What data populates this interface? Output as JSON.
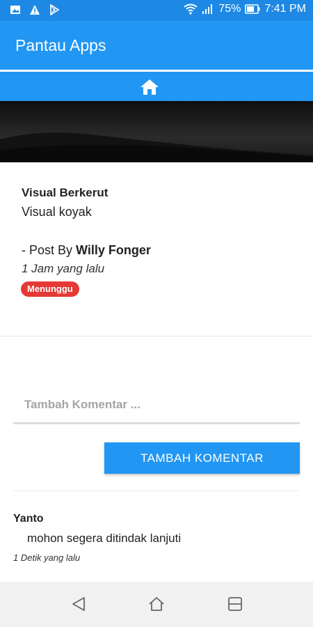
{
  "status_bar": {
    "battery": "75%",
    "time": "7:41 PM",
    "icons": [
      "image-icon",
      "warning-icon",
      "play-store-icon",
      "wifi-icon",
      "signal-icon",
      "battery-icon"
    ]
  },
  "app_bar": {
    "title": "Pantau Apps"
  },
  "home_bar": {
    "icon": "home-icon"
  },
  "post": {
    "title": "Visual Berkerut",
    "description": "Visual koyak",
    "by_prefix": "- Post By ",
    "author": "Willy Fonger",
    "time": "1 Jam yang lalu",
    "status": "Menunggu"
  },
  "comment_form": {
    "placeholder": "Tambah Komentar ...",
    "button_label": "TAMBAH KOMENTAR"
  },
  "comments": [
    {
      "author": "Yanto",
      "text": "mohon segera ditindak lanjuti",
      "time": "1 Detik yang lalu"
    }
  ],
  "colors": {
    "primary": "#2196f3",
    "status_bar": "#1e88e5",
    "badge": "#e53935"
  }
}
